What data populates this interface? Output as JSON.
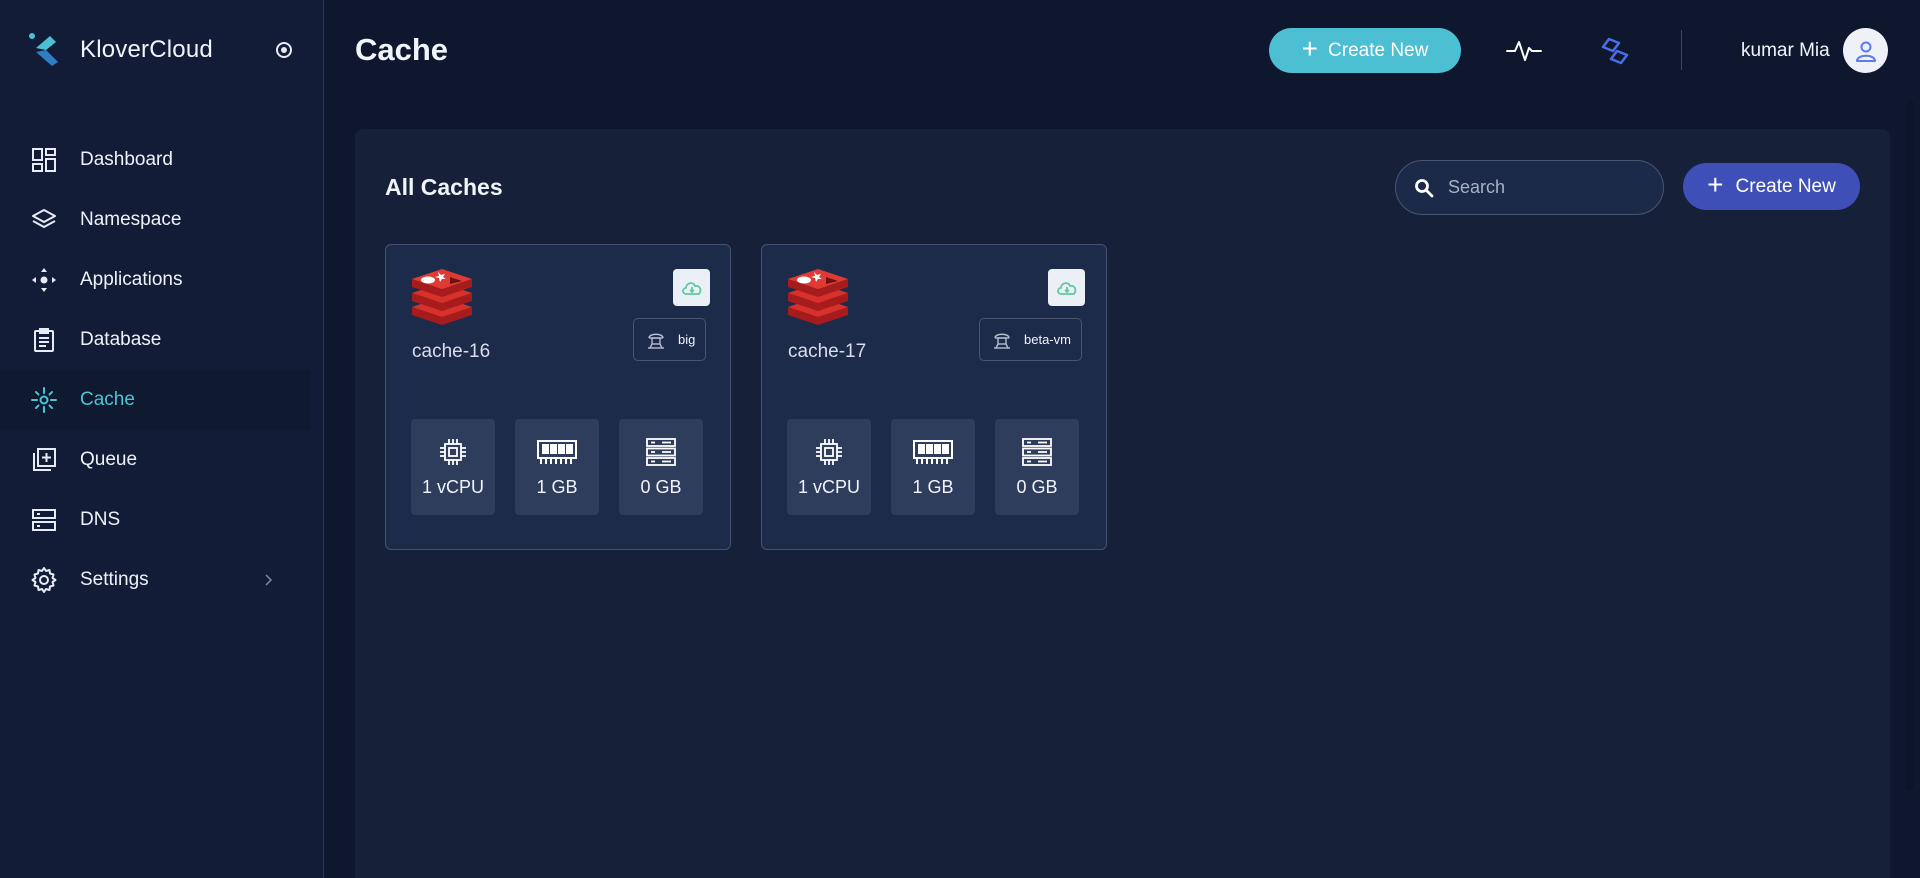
{
  "brand": {
    "name": "KloverCloud"
  },
  "sidebar": {
    "items": [
      {
        "label": "Dashboard",
        "icon": "dashboard-icon"
      },
      {
        "label": "Namespace",
        "icon": "layers-icon"
      },
      {
        "label": "Applications",
        "icon": "applications-icon"
      },
      {
        "label": "Database",
        "icon": "clipboard-icon"
      },
      {
        "label": "Cache",
        "icon": "cache-icon",
        "active": true
      },
      {
        "label": "Queue",
        "icon": "queue-icon"
      },
      {
        "label": "DNS",
        "icon": "dns-icon"
      },
      {
        "label": "Settings",
        "icon": "gear-icon",
        "has_submenu": true
      }
    ]
  },
  "header": {
    "title": "Cache",
    "create_label": "Create New",
    "user_name": "kumar Mia"
  },
  "panel": {
    "title": "All Caches",
    "search_placeholder": "Search",
    "create_label": "Create New"
  },
  "caches": [
    {
      "name": "cache-16",
      "cluster": "big",
      "specs": {
        "cpu": "1 vCPU",
        "memory": "1 GB",
        "storage": "0 GB"
      }
    },
    {
      "name": "cache-17",
      "cluster": "beta-vm",
      "specs": {
        "cpu": "1 vCPU",
        "memory": "1 GB",
        "storage": "0 GB"
      }
    }
  ],
  "colors": {
    "accent_teal": "#4cbfd3",
    "accent_indigo": "#3e50b7",
    "redis_red": "#c9302c",
    "background": "#0f172f"
  }
}
